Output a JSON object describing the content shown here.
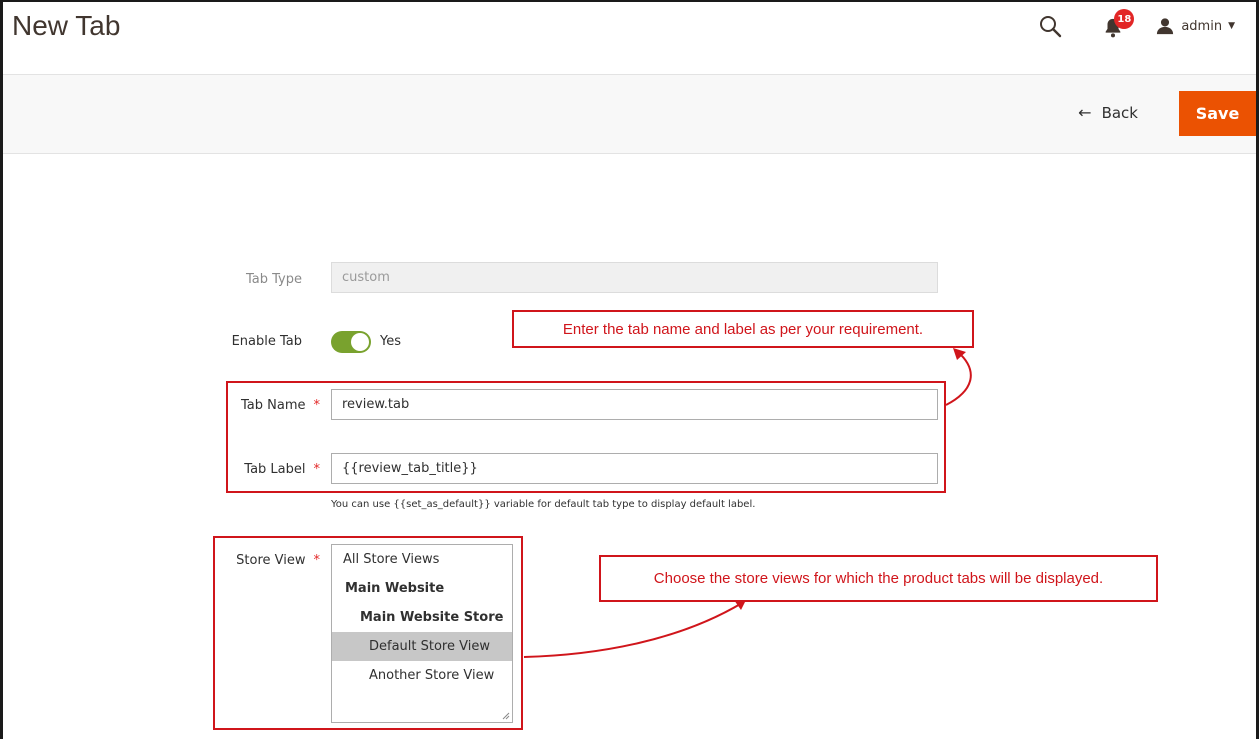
{
  "header": {
    "title": "New Tab",
    "notification_count": "18",
    "user_name": "admin"
  },
  "actions": {
    "back_label": "Back",
    "save_label": "Save"
  },
  "form": {
    "tab_type": {
      "label": "Tab Type",
      "value": "custom"
    },
    "enable_tab": {
      "label": "Enable Tab",
      "state": "Yes",
      "on": true
    },
    "tab_name": {
      "label": "Tab Name",
      "value": "review.tab",
      "required": "*"
    },
    "tab_label": {
      "label": "Tab Label",
      "value": "{{review_tab_title}}",
      "required": "*"
    },
    "tab_label_note": "You can use {{set_as_default}} variable for default tab type to display default label.",
    "store_view": {
      "label": "Store View",
      "required": "*",
      "options": [
        {
          "text": "All Store Views"
        },
        {
          "text": "Main Website"
        },
        {
          "text": "Main Website Store"
        },
        {
          "text": "Default Store View"
        },
        {
          "text": "Another Store View"
        }
      ]
    }
  },
  "annotations": {
    "name_label_callout": "Enter the tab name and label as per your requirement.",
    "store_view_callout": "Choose the store views for which the product tabs will be displayed."
  },
  "colors": {
    "accent": "#eb5202",
    "toggle_on": "#79a22e",
    "callout": "#d0151b",
    "badge": "#e22626"
  }
}
